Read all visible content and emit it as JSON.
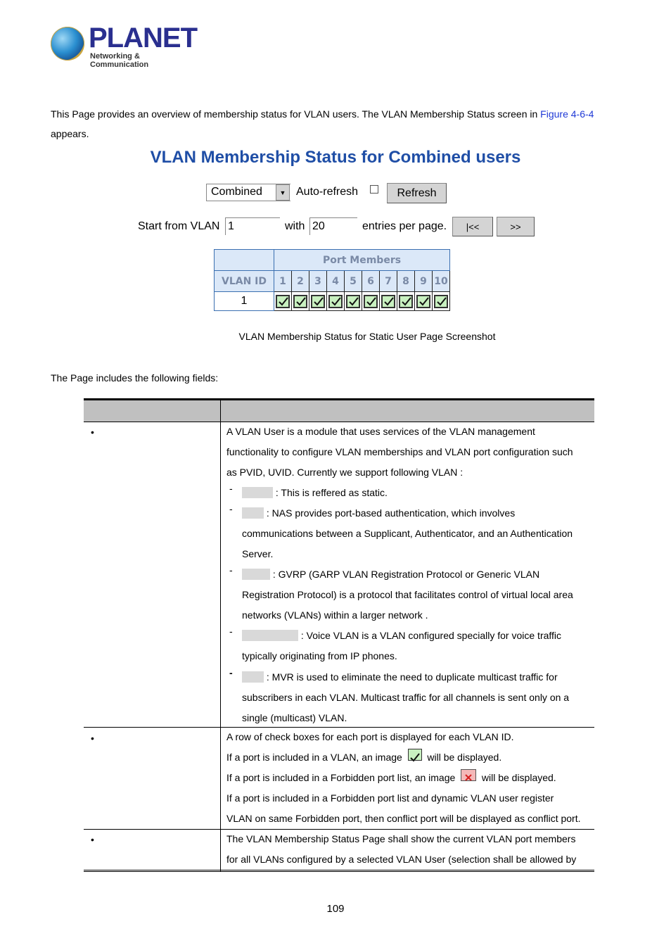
{
  "header": {
    "logo_name": "PLANET",
    "logo_tagline": "Networking & Communication"
  },
  "intro": {
    "text_before_link": "This Page provides an overview of membership status for VLAN users. The VLAN Membership Status screen in ",
    "link_text": "Figure 4-6-4",
    "text_after_link": "appears."
  },
  "screenshot": {
    "title": "VLAN Membership Status for Combined users",
    "user_select": {
      "value": "Combined"
    },
    "auto_refresh_label": "Auto-refresh",
    "auto_refresh_checked": false,
    "refresh_button": "Refresh",
    "start_label": "Start from VLAN",
    "start_value": "1",
    "with_label": "with",
    "entries_value": "20",
    "entries_label": "entries per page.",
    "first_button": "|<<",
    "next_button": ">>",
    "table": {
      "group_header": "Port Members",
      "vlan_id_header": "VLAN ID",
      "ports": [
        "1",
        "2",
        "3",
        "4",
        "5",
        "6",
        "7",
        "8",
        "9",
        "10"
      ],
      "rows": [
        {
          "vlan_id": "1",
          "members": [
            "member",
            "member",
            "member",
            "member",
            "member",
            "member",
            "member",
            "member",
            "member",
            "member"
          ]
        }
      ]
    },
    "caption": "VLAN Membership Status for Static User Page Screenshot"
  },
  "fields_intro": "The Page includes the following fields:",
  "fields_table": {
    "headers": [
      "",
      ""
    ],
    "rows": [
      {
        "bullet": "•",
        "lines": [
          "A VLAN User is a module that uses services of the VLAN management",
          "functionality to configure VLAN memberships and VLAN port configuration such",
          "as PVID, UVID. Currently we support following VLAN :"
        ],
        "subitems": [
          {
            "dash": "-",
            "lines": [
              ": This is reffered as static."
            ]
          },
          {
            "dash": "-",
            "lines": [
              ": NAS provides port-based authentication, which involves",
              "communications between a Supplicant, Authenticator, and an Authentication",
              "Server."
            ]
          },
          {
            "dash": "-",
            "lines": [
              ": GVRP (GARP VLAN Registration Protocol or Generic VLAN",
              "Registration Protocol) is a protocol that facilitates control of virtual local area",
              "networks (VLANs) within a larger network ."
            ]
          },
          {
            "dash": "-",
            "lines": [
              ": Voice VLAN is a VLAN configured specially for voice traffic",
              "typically originating from IP phones."
            ]
          },
          {
            "dash": "-",
            "lines": [
              ": MVR is used to eliminate the need to duplicate multicast traffic for",
              "subscribers in each VLAN. Multicast traffic for all channels is sent only on a",
              "single (multicast) VLAN."
            ]
          }
        ]
      },
      {
        "bullet": "•",
        "lines": [
          "A row of check boxes for each port is displayed for each VLAN ID.",
          "If a port is included in a VLAN, an image",
          "will be displayed.",
          "If a port is included in a Forbidden port list, an image",
          "will be displayed.",
          "If a port is included in a Forbidden port list and dynamic VLAN user register",
          "VLAN on same Forbidden port, then conflict port will be displayed as conflict port."
        ]
      },
      {
        "bullet": "•",
        "lines": [
          "The VLAN Membership Status Page shall show the current VLAN port members",
          "for all VLANs configured by a selected VLAN User (selection shall be allowed by"
        ]
      }
    ]
  },
  "page_number": "109"
}
